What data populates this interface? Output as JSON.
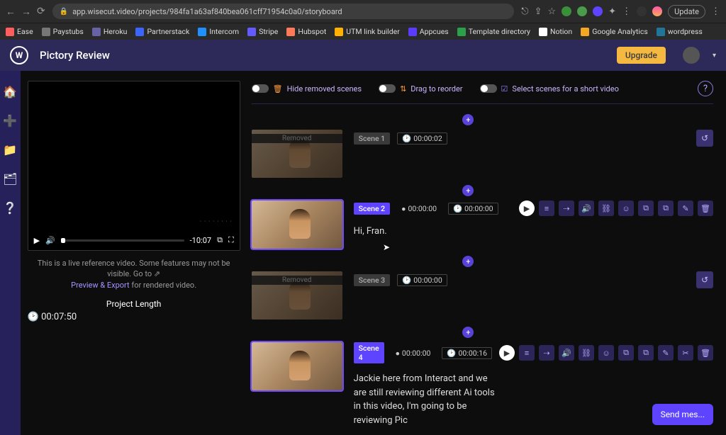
{
  "browser": {
    "url": "app.wisecut.video/projects/984fa1a63af840bea061cff71954c0a0/storyboard",
    "update": "Update",
    "bookmarks": [
      {
        "label": "Ease",
        "color": "#ff5e5e"
      },
      {
        "label": "Paystubs",
        "color": "#777"
      },
      {
        "label": "Heroku",
        "color": "#6762a6"
      },
      {
        "label": "Partnerstack",
        "color": "#3a66ff"
      },
      {
        "label": "Intercom",
        "color": "#1e90ff"
      },
      {
        "label": "Stripe",
        "color": "#635bff"
      },
      {
        "label": "Hubspot",
        "color": "#ff7a59"
      },
      {
        "label": "UTM link builder",
        "color": "#ffb000"
      },
      {
        "label": "Appcues",
        "color": "#5b3cff"
      },
      {
        "label": "Template directory",
        "color": "#2aa04a"
      },
      {
        "label": "Notion",
        "color": "#fff"
      },
      {
        "label": "Google Analytics",
        "color": "#f5a623"
      },
      {
        "label": "wordpress",
        "color": "#21759b"
      }
    ]
  },
  "header": {
    "title": "Pictory Review",
    "upgrade": "Upgrade"
  },
  "player": {
    "duration": "-10:07",
    "note_pre": "This is a live reference video. Some features may not be visible. Go to ",
    "note_link": "Preview & Export",
    "note_post": " for rendered video.",
    "length_label": "Project Length",
    "length_time": "00:07:50"
  },
  "toggles": {
    "hide": "Hide removed scenes",
    "drag": "Drag to reorder",
    "select": "Select scenes for a short video"
  },
  "scenes": [
    {
      "badge": "Scene 1",
      "removed": true,
      "time1": "00:00:02",
      "transcript": ""
    },
    {
      "badge": "Scene 2",
      "removed": false,
      "time1": "00:00:00",
      "time2": "00:00:00",
      "transcript": "Hi, Fran."
    },
    {
      "badge": "Scene 3",
      "removed": true,
      "time1": "00:00:00",
      "transcript": ""
    },
    {
      "badge": "Scene 4",
      "removed": false,
      "time1": "00:00:00",
      "time2": "00:00:16",
      "transcript": "Jackie here from Interact and we are still reviewing different Ai tools in this video, I'm going to be reviewing Pic"
    }
  ],
  "chat": {
    "label": "Send mes..."
  }
}
